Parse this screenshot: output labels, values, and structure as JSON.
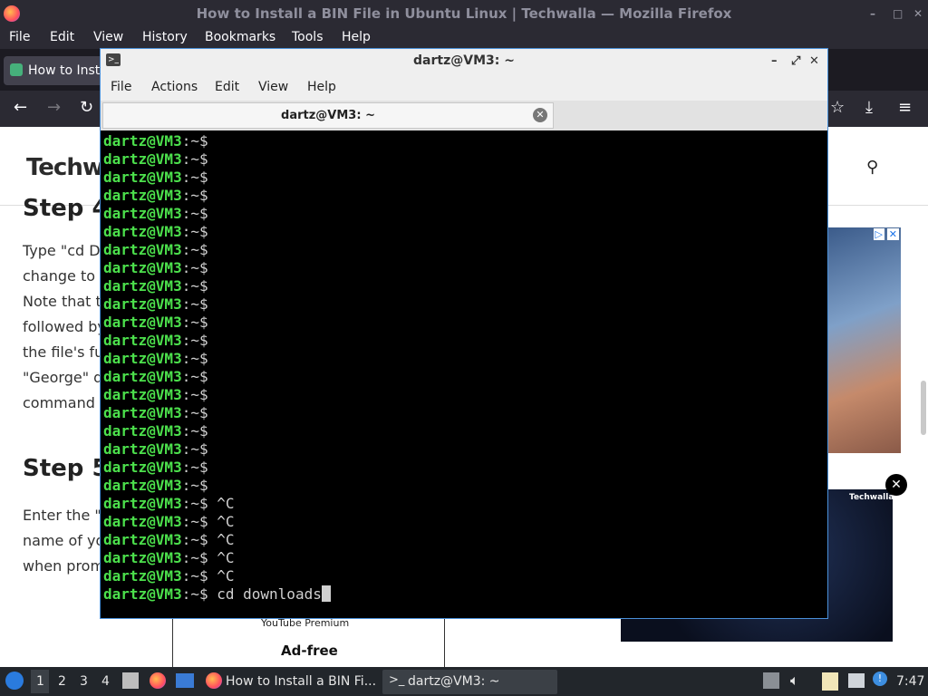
{
  "firefox": {
    "window_title": "How to Install a BIN File in Ubuntu Linux | Techwalla — Mozilla Firefox",
    "menu": [
      "File",
      "Edit",
      "View",
      "History",
      "Bookmarks",
      "Tools",
      "Help"
    ],
    "tab_title": "How to Insta",
    "win_controls": [
      "–",
      "□",
      "✕"
    ]
  },
  "page": {
    "logo": "Techwa",
    "step4_heading": "Step 4",
    "paragraph_lines": [
      "Type \"cd Do",
      "change to t",
      "Note that te",
      "followed by",
      "the file's ful",
      "\"George\" di",
      "command to"
    ],
    "step5_heading": "Step 5",
    "step5_lines": [
      "Enter the \"s",
      "name of you",
      "when prom"
    ],
    "ad_logo": "Techwalla",
    "ad_youtube": "YouTube Premium",
    "ad_free": "Ad-free",
    "ad_close": "✕"
  },
  "terminal": {
    "title": "dartz@VM3: ~",
    "tab_label": "dartz@VM3: ~",
    "menu": [
      "File",
      "Actions",
      "Edit",
      "View",
      "Help"
    ],
    "prompt_user": "dartz@VM3",
    "prompt_dir": ":~",
    "prompt_sym": "$",
    "lines": [
      "",
      "",
      "",
      "",
      "",
      "",
      "",
      "",
      "",
      "",
      "",
      "",
      "",
      "",
      "",
      "",
      "",
      "",
      "",
      "",
      " ^C",
      " ^C",
      " ^C",
      " ^C",
      " ^C",
      " cd downloads"
    ]
  },
  "taskbar": {
    "workspaces": [
      "1",
      "2",
      "3",
      "4"
    ],
    "firefox_task": "How to Install a BIN Fi...",
    "terminal_task": "dartz@VM3: ~",
    "clock": "7:47"
  }
}
